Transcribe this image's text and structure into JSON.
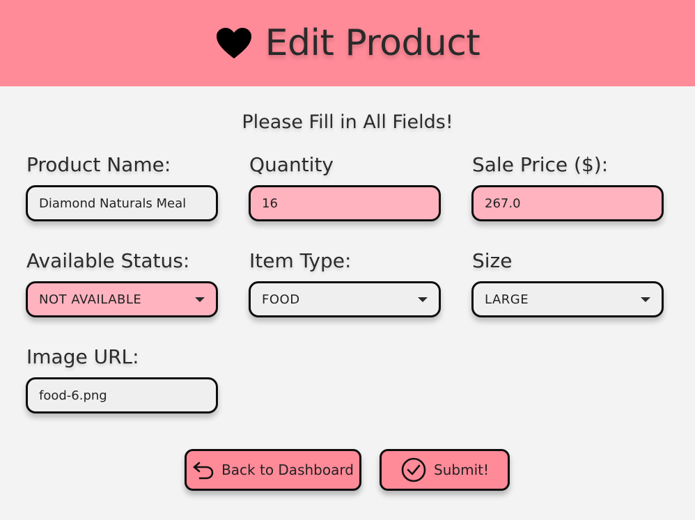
{
  "header": {
    "title": "Edit Product",
    "icon": "heart-icon",
    "background": "#ff8a98"
  },
  "subtitle": "Please Fill in All Fields!",
  "fields": {
    "product_name": {
      "label": "Product Name:",
      "value": "Diamond Naturals Meal"
    },
    "quantity": {
      "label": "Quantity",
      "value": "16"
    },
    "sale_price": {
      "label": "Sale Price ($):",
      "value": "267.0"
    },
    "available_status": {
      "label": "Available Status:",
      "value": "NOT AVAILABLE"
    },
    "item_type": {
      "label": "Item Type:",
      "value": "FOOD"
    },
    "size": {
      "label": "Size",
      "value": "LARGE"
    },
    "image_url": {
      "label": "Image URL:",
      "value": "food-6.png"
    }
  },
  "buttons": {
    "back": {
      "label": "Back to Dashboard",
      "icon": "undo-arrow-icon"
    },
    "submit": {
      "label": "Submit!",
      "icon": "check-circle-icon"
    }
  },
  "colors": {
    "accent": "#ff8a98",
    "field_highlight": "#ffb3bf",
    "field_default": "#efefef",
    "background": "#f3f3f3"
  }
}
